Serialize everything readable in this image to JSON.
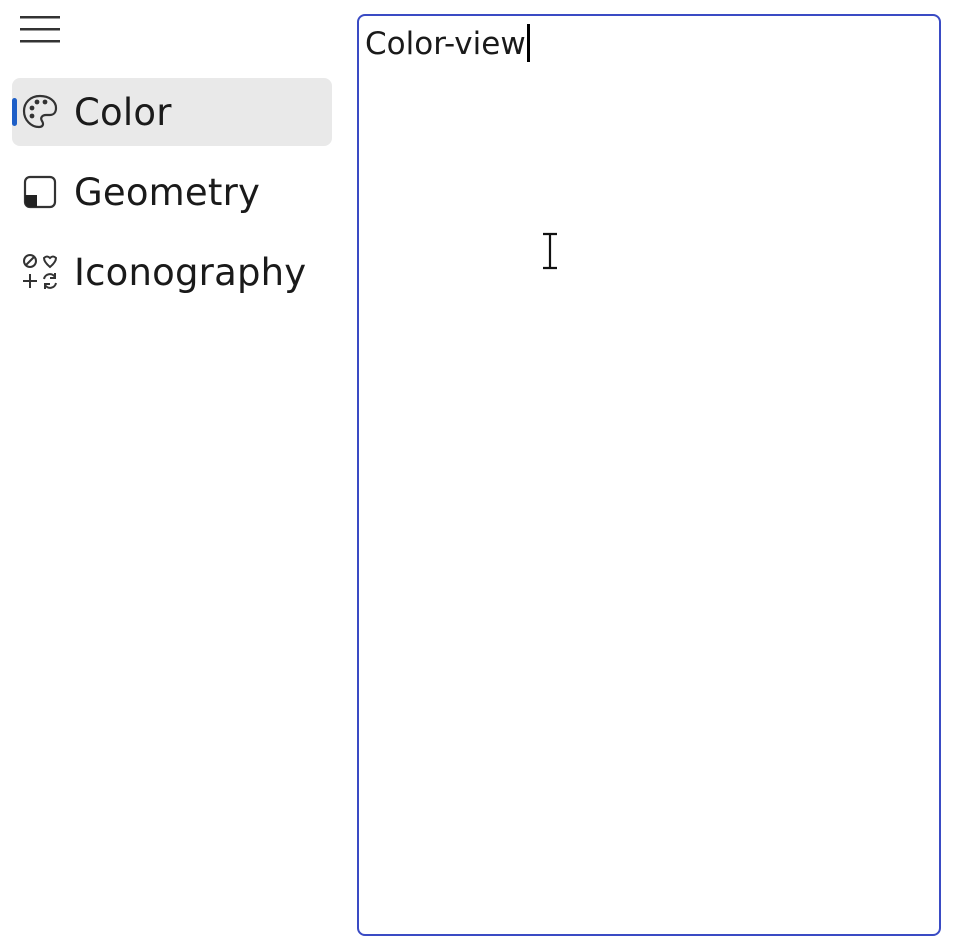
{
  "menu": {
    "toggle_icon": "hamburger-icon"
  },
  "nav": {
    "items": [
      {
        "label": "Color",
        "icon": "palette-icon",
        "selected": true
      },
      {
        "label": "Geometry",
        "icon": "shape-square-icon",
        "selected": false
      },
      {
        "label": "Iconography",
        "icon": "symbols-icon",
        "selected": false
      }
    ]
  },
  "content": {
    "text": "Color-view"
  },
  "colors": {
    "accent": "#1e5fc7",
    "border": "#3a4bc4",
    "selected_bg": "#e9e9e9"
  }
}
